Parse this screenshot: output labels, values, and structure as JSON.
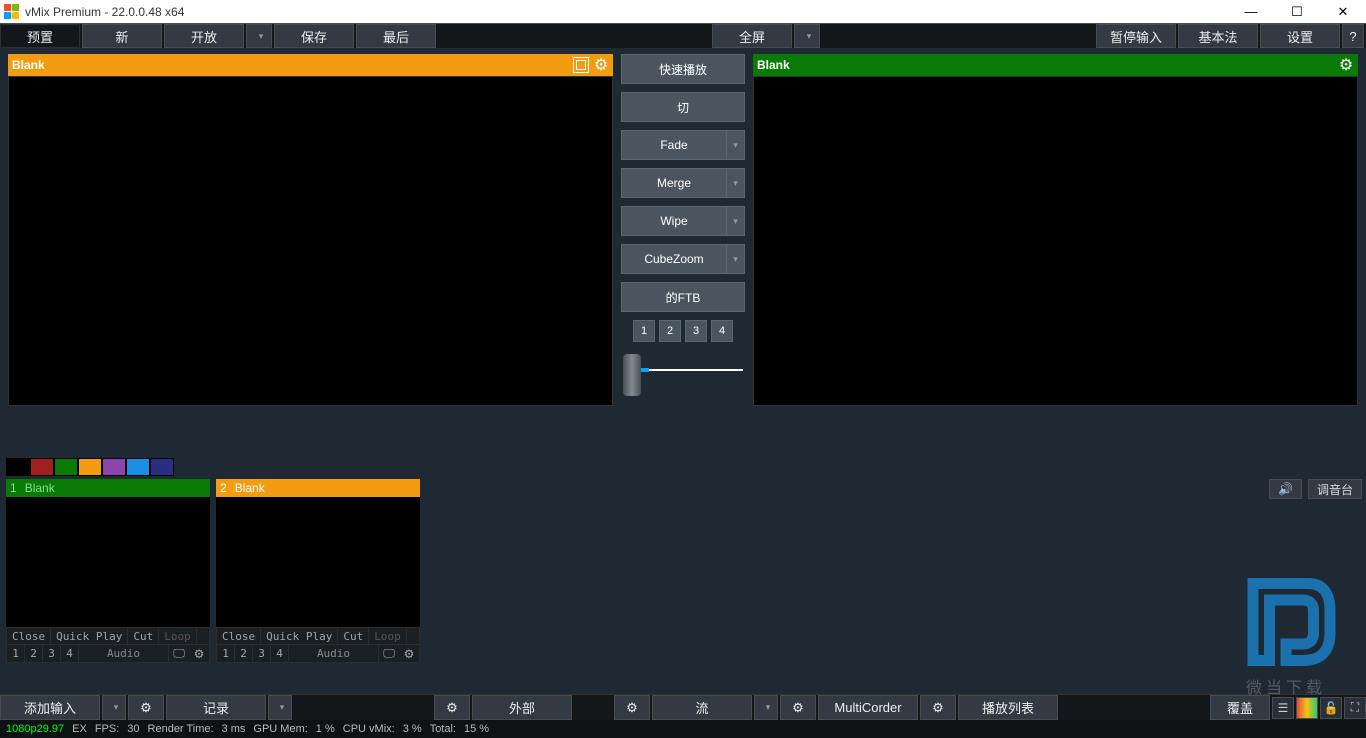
{
  "title": "vMix Premium - 22.0.0.48 x64",
  "toolbar": {
    "preset": "预置",
    "new": "新",
    "open": "开放",
    "save": "保存",
    "last": "最后",
    "fullscreen": "全屏",
    "pause": "暂停输入",
    "basic": "基本法",
    "settings": "设置",
    "help": "?"
  },
  "preview": {
    "left_title": "Blank",
    "right_title": "Blank"
  },
  "transitions": {
    "quick": "快速播放",
    "cut": "切",
    "fade": "Fade",
    "merge": "Merge",
    "wipe": "Wipe",
    "cube": "CubeZoom",
    "ftb": "的FTB",
    "n1": "1",
    "n2": "2",
    "n3": "3",
    "n4": "4"
  },
  "colorstrip": [
    "#000000",
    "#a02020",
    "#0a7a06",
    "#f39c12",
    "#8e44ad",
    "#1a8fe3",
    "#2a2e80"
  ],
  "audiobar": {
    "mixer": "调音台"
  },
  "inputs": [
    {
      "num": "1",
      "name": "Blank",
      "style": "green",
      "close": "Close",
      "quick": "Quick Play",
      "cut": "Cut",
      "loop": "Loop",
      "audio": "Audio"
    },
    {
      "num": "2",
      "name": "Blank",
      "style": "orange",
      "close": "Close",
      "quick": "Quick Play",
      "cut": "Cut",
      "loop": "Loop",
      "audio": "Audio"
    }
  ],
  "bottombar": {
    "add": "添加输入",
    "record": "记录",
    "external": "外部",
    "stream": "流",
    "multi": "MultiCorder",
    "playlist": "播放列表",
    "overlay": "覆盖"
  },
  "status": {
    "res": "1080p29.97",
    "ex": "EX",
    "fps_l": "FPS:",
    "fps": "30",
    "rt_l": "Render Time:",
    "rt": "3 ms",
    "gpu_l": "GPU Mem:",
    "gpu": "1 %",
    "cpu_l": "CPU vMix:",
    "cpu": "3 %",
    "tot_l": "Total:",
    "tot": "15 %"
  },
  "watermark": "微当下载"
}
